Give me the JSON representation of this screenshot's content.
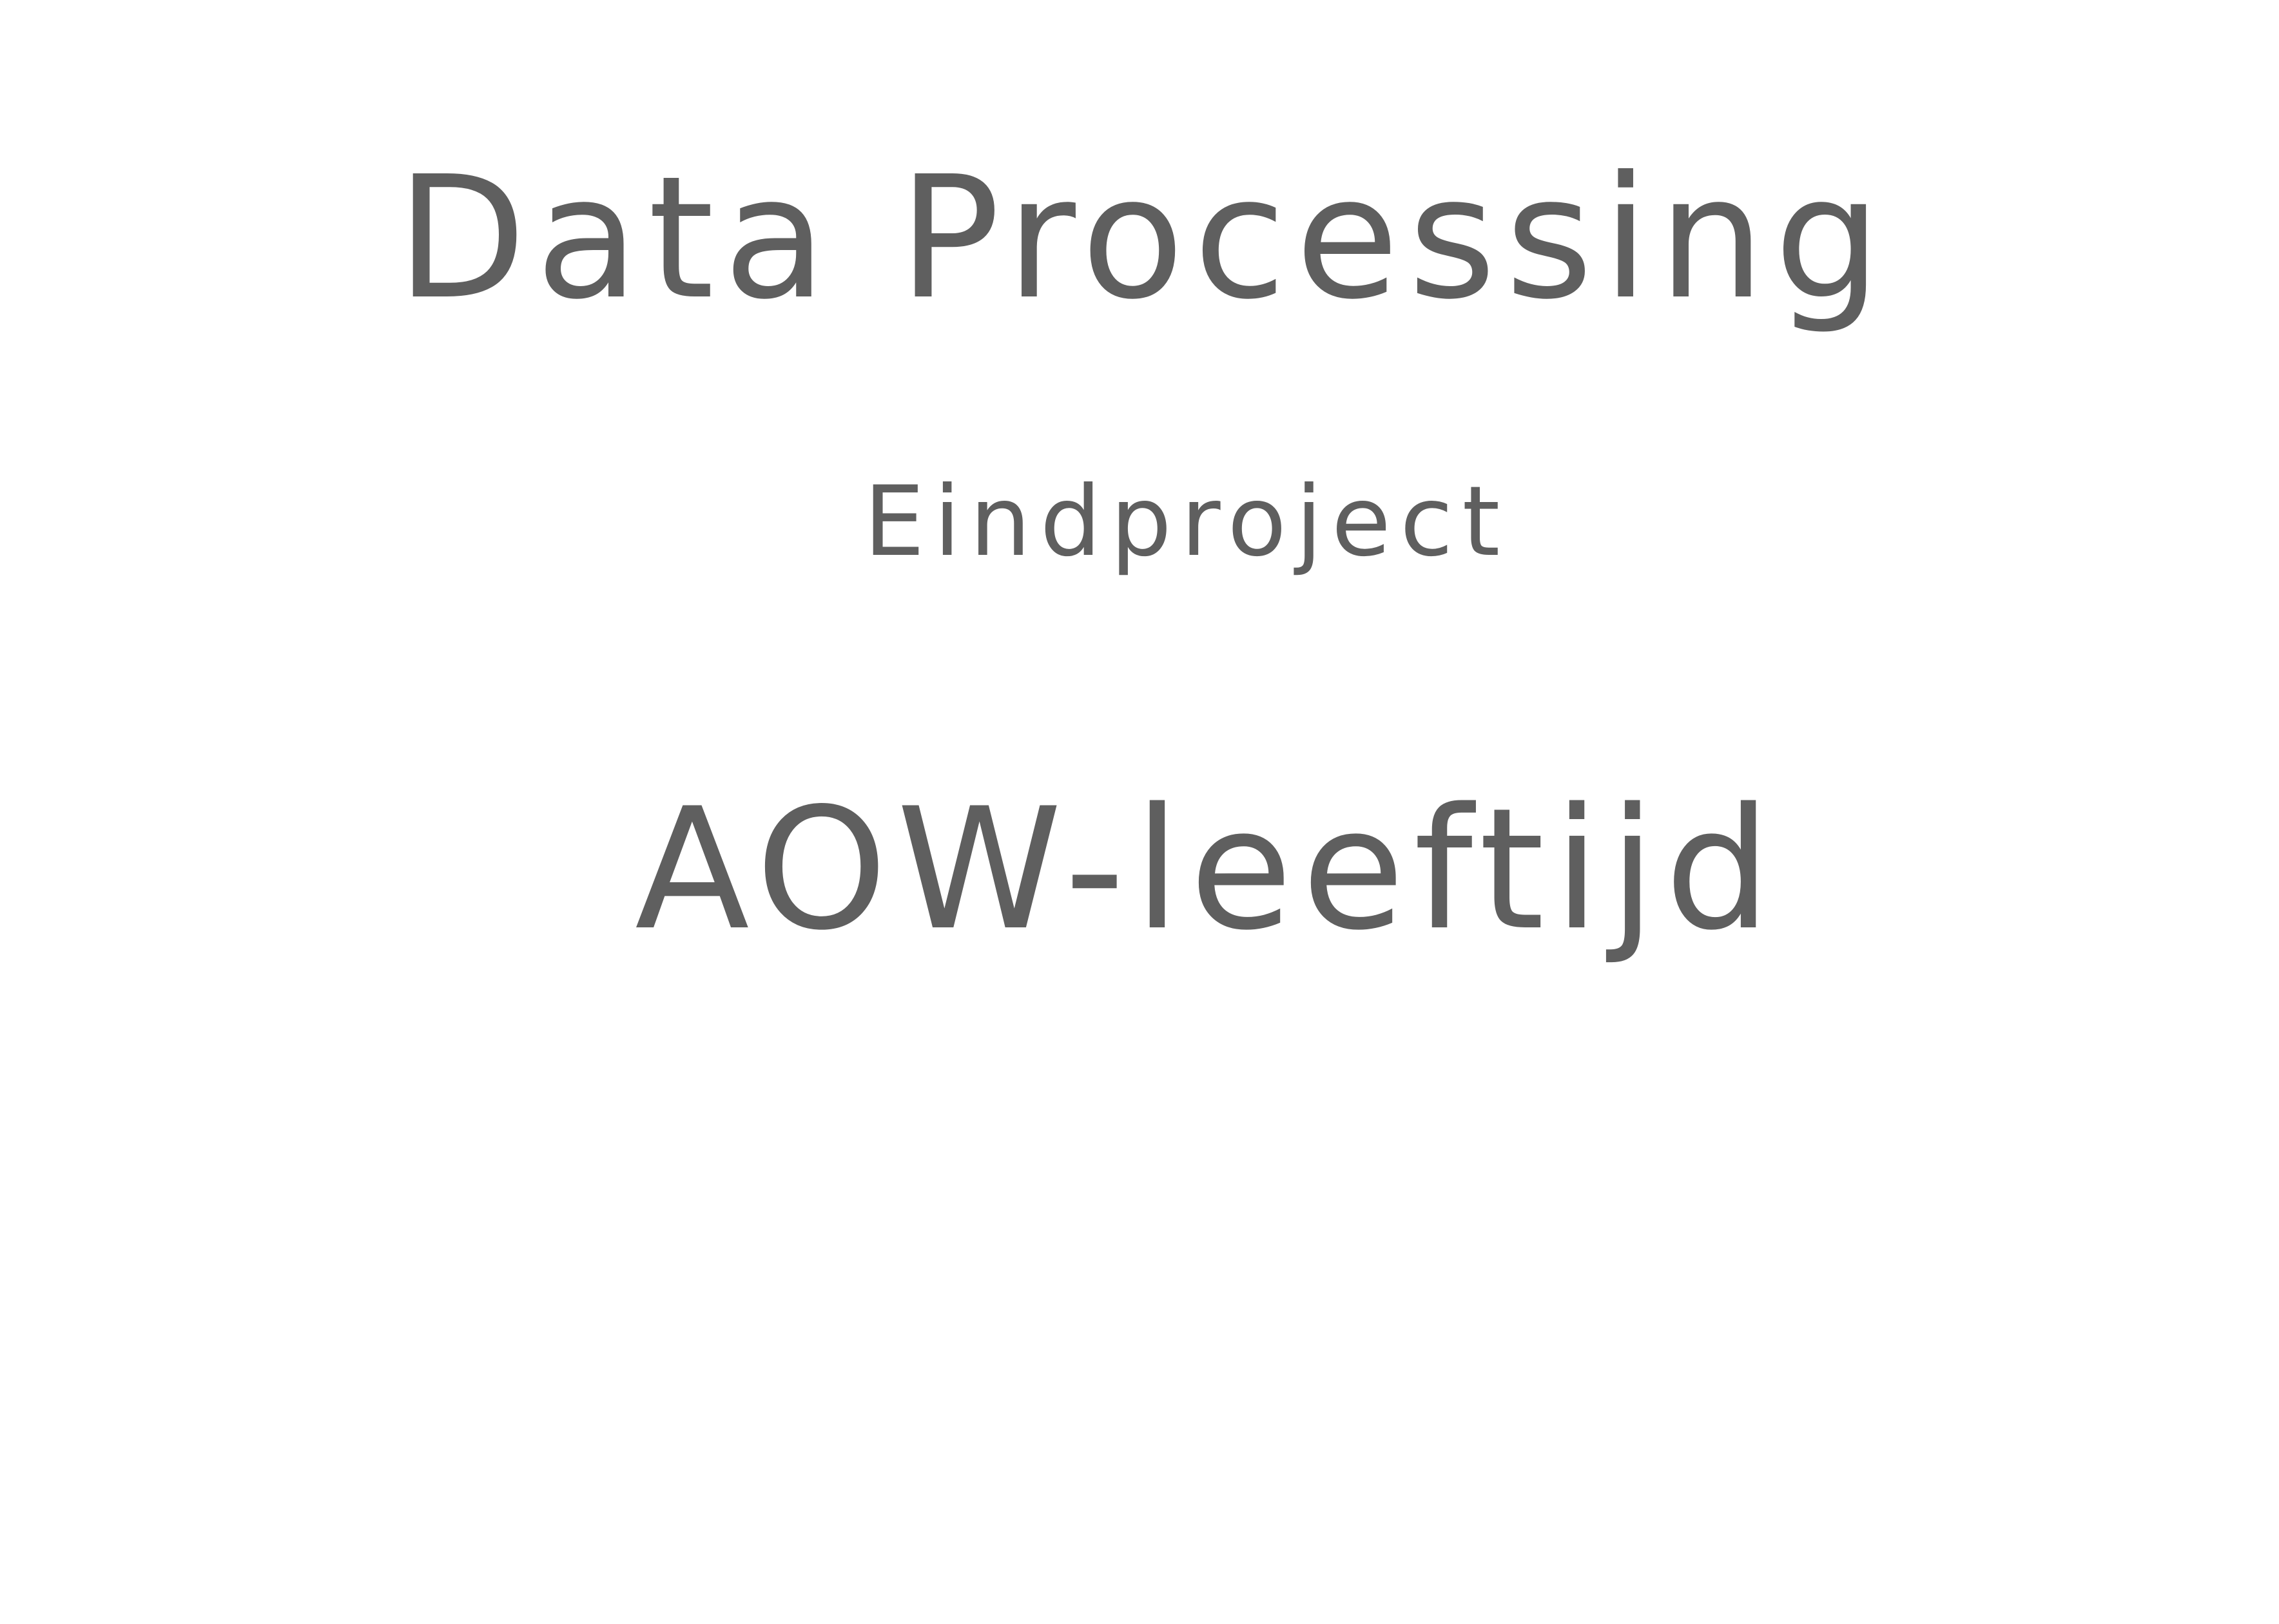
{
  "document": {
    "title": "Data Processing",
    "subtitle": "Eindproject",
    "topic": "AOW-leeftijd"
  },
  "colors": {
    "ink": "#5f5f5f",
    "paper": "#ffffff"
  }
}
